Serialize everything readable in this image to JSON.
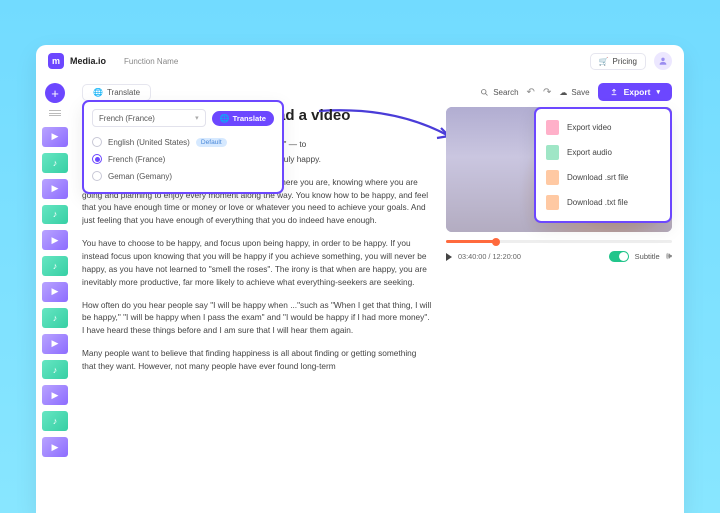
{
  "brand": {
    "logo_glyph": "m",
    "name": "Media.io",
    "function": "Function Name"
  },
  "topbar": {
    "pricing_label": "Pricing"
  },
  "toolbar": {
    "translate_label": "Translate",
    "search_label": "Search",
    "save_label": "Save",
    "export_label": "Export"
  },
  "translate_popup": {
    "selected": "French (France)",
    "action": "Translate",
    "options": [
      {
        "label": "English (United States)",
        "default": true
      },
      {
        "label": "French (France)",
        "selected": true
      },
      {
        "label": "Geman (Gemany)"
      }
    ],
    "default_pill": "Default"
  },
  "export_popup": {
    "items": [
      {
        "label": "Export video",
        "kind": "v"
      },
      {
        "label": "Export audio",
        "kind": "a"
      },
      {
        "label": "Download .srt file",
        "kind": "s"
      },
      {
        "label": "Download .txt file",
        "kind": "t"
      }
    ]
  },
  "document": {
    "title_suffix": "ribe Upload a video",
    "p1_suffix": "ne to \"smell the roses\" — to",
    "p2_suffix": "This is part of being truly happy.",
    "p3": "Happiness is a state of mind. It starts with accepting where you are, knowing where you are going and planning to enjoy every moment along the way. You know how to be happy, and feel that you have enough time or money or love or whatever you need to achieve your goals. And just feeling that you have enough of everything that you do indeed have enough.",
    "p4": "You have to choose to be happy, and focus upon being happy, in order to be happy. If you instead focus upon knowing that you will be happy if you achieve something, you will never be happy, as you have not learned to \"smell the roses\". The irony is that when are happy, you are inevitably more productive,  far more likely to achieve what everything-seekers are seeking.",
    "p5": "How often do you hear people say \"I will be happy when ...\"such as \"When I get that thing, I will be happy,\" \"I will be happy when I pass the exam\" and \"I would be happy if I had more money\". I have heard these things before and I am sure that I will hear them again.",
    "p6": "Many people want to believe that finding happiness is all about finding or getting something that they want. However, not many people have ever found long-term"
  },
  "player": {
    "current": "03:40:00",
    "total": "12:20:00",
    "subtitle_label": "Subtitle"
  }
}
